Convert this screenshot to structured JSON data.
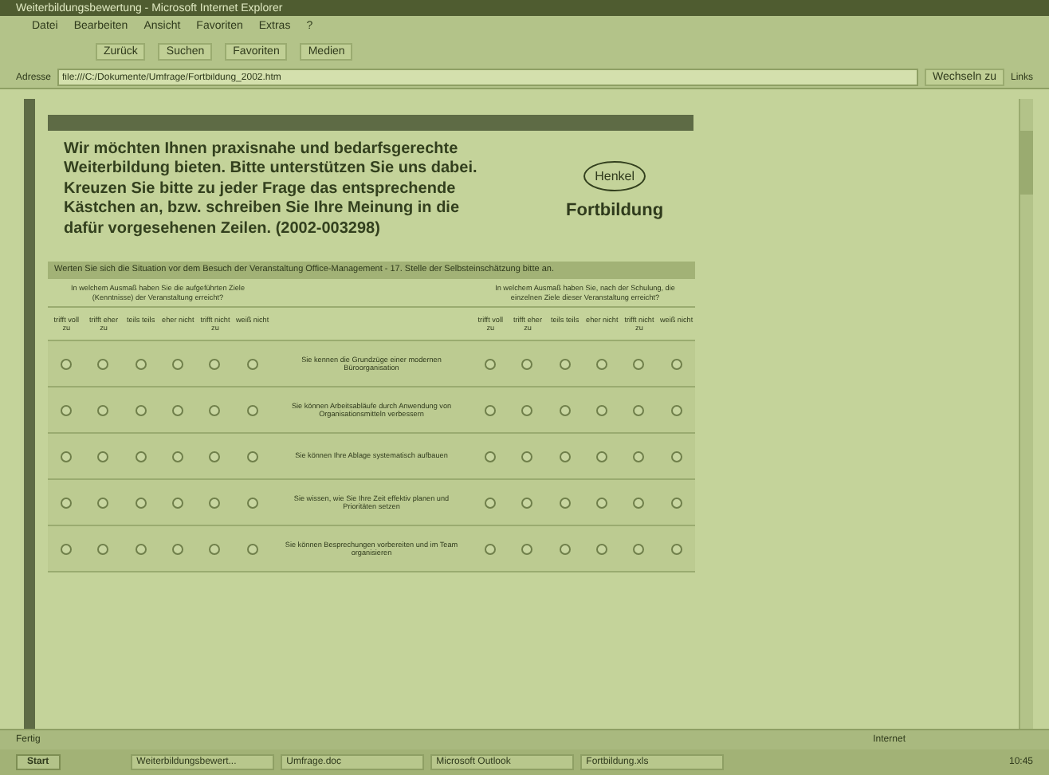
{
  "window": {
    "title": "Weiterbildungsbewertung - Microsoft Internet Explorer"
  },
  "menu": [
    "Datei",
    "Bearbeiten",
    "Ansicht",
    "Favoriten",
    "Extras",
    "?"
  ],
  "toolbar": [
    "Zurück",
    "Suchen",
    "Favoriten",
    "Medien"
  ],
  "address": {
    "label": "Adresse",
    "value": "file:///C:/Dokumente/Umfrage/Fortbildung_2002.htm",
    "go": "Wechseln zu",
    "links": "Links"
  },
  "intro": "Wir möchten Ihnen praxisnahe und bedarfsgerechte Weiterbildung bieten. Bitte unterstützen Sie uns dabei. Kreuzen Sie bitte zu jeder Frage das entsprechende Kästchen an, bzw. schreiben Sie Ihre Meinung in die dafür vorgesehenen Zeilen. (2002-003298)",
  "logo": {
    "mark": "Henkel",
    "caption": "Fortbildung"
  },
  "survey": {
    "heading": "Werten Sie sich die Situation vor dem Besuch der Veranstaltung Office-Management - 17. Stelle der Selbsteinschätzung bitte an.",
    "left_question": "In welchem Ausmaß haben Sie die aufgeführten Ziele (Kenntnisse) der Veranstaltung erreicht?",
    "right_question": "In welchem Ausmaß haben Sie, nach der Schulung, die einzelnen Ziele dieser Veranstaltung erreicht?",
    "left_scale": [
      "trifft voll zu",
      "trifft eher zu",
      "teils teils",
      "eher nicht",
      "trifft nicht zu",
      "weiß nicht"
    ],
    "right_scale": [
      "trifft voll zu",
      "trifft eher zu",
      "teils teils",
      "eher nicht",
      "trifft nicht zu",
      "weiß nicht"
    ],
    "rows": [
      {
        "item": "Sie kennen die Grundzüge einer modernen Büroorganisation",
        "left": [
          {
            "selected": false
          },
          {
            "selected": false
          },
          {
            "selected": false
          },
          {
            "selected": false
          },
          {
            "selected": false
          },
          {
            "selected": false
          }
        ],
        "right": [
          {
            "selected": false
          },
          {
            "selected": false
          },
          {
            "selected": false
          },
          {
            "selected": false
          },
          {
            "selected": false
          },
          {
            "selected": false
          }
        ]
      },
      {
        "item": "Sie können Arbeitsabläufe durch Anwendung von Organisationsmitteln verbessern",
        "left": [
          {
            "selected": false
          },
          {
            "selected": false
          },
          {
            "selected": false
          },
          {
            "selected": false
          },
          {
            "selected": false
          },
          {
            "selected": false
          }
        ],
        "right": [
          {
            "selected": false
          },
          {
            "selected": false
          },
          {
            "selected": false
          },
          {
            "selected": false
          },
          {
            "selected": false
          },
          {
            "selected": false
          }
        ]
      },
      {
        "item": "Sie können Ihre Ablage systematisch aufbauen",
        "left": [
          {
            "selected": false
          },
          {
            "selected": false
          },
          {
            "selected": false
          },
          {
            "selected": false
          },
          {
            "selected": false
          },
          {
            "selected": false
          }
        ],
        "right": [
          {
            "selected": false
          },
          {
            "selected": false
          },
          {
            "selected": false
          },
          {
            "selected": false
          },
          {
            "selected": false
          },
          {
            "selected": false
          }
        ]
      },
      {
        "item": "Sie wissen, wie Sie Ihre Zeit effektiv planen und Prioritäten setzen",
        "left": [
          {
            "selected": false
          },
          {
            "selected": false
          },
          {
            "selected": false
          },
          {
            "selected": false
          },
          {
            "selected": false
          },
          {
            "selected": false
          }
        ],
        "right": [
          {
            "selected": false
          },
          {
            "selected": false
          },
          {
            "selected": false
          },
          {
            "selected": false
          },
          {
            "selected": false
          },
          {
            "selected": false
          }
        ]
      },
      {
        "item": "Sie können Besprechungen vorbereiten und im Team organisieren",
        "left": [
          {
            "selected": false
          },
          {
            "selected": false
          },
          {
            "selected": false
          },
          {
            "selected": false
          },
          {
            "selected": false
          },
          {
            "selected": false
          }
        ],
        "right": [
          {
            "selected": false
          },
          {
            "selected": false
          },
          {
            "selected": false
          },
          {
            "selected": false
          },
          {
            "selected": false
          },
          {
            "selected": false
          }
        ]
      }
    ]
  },
  "status_bar": {
    "left": "Fertig",
    "zone": "Internet"
  },
  "taskbar": {
    "start": "Start",
    "tasks": [
      "Weiterbildungsbewert...",
      "Umfrage.doc",
      "Microsoft Outlook",
      "Fortbildung.xls"
    ],
    "clock": "10:45"
  }
}
